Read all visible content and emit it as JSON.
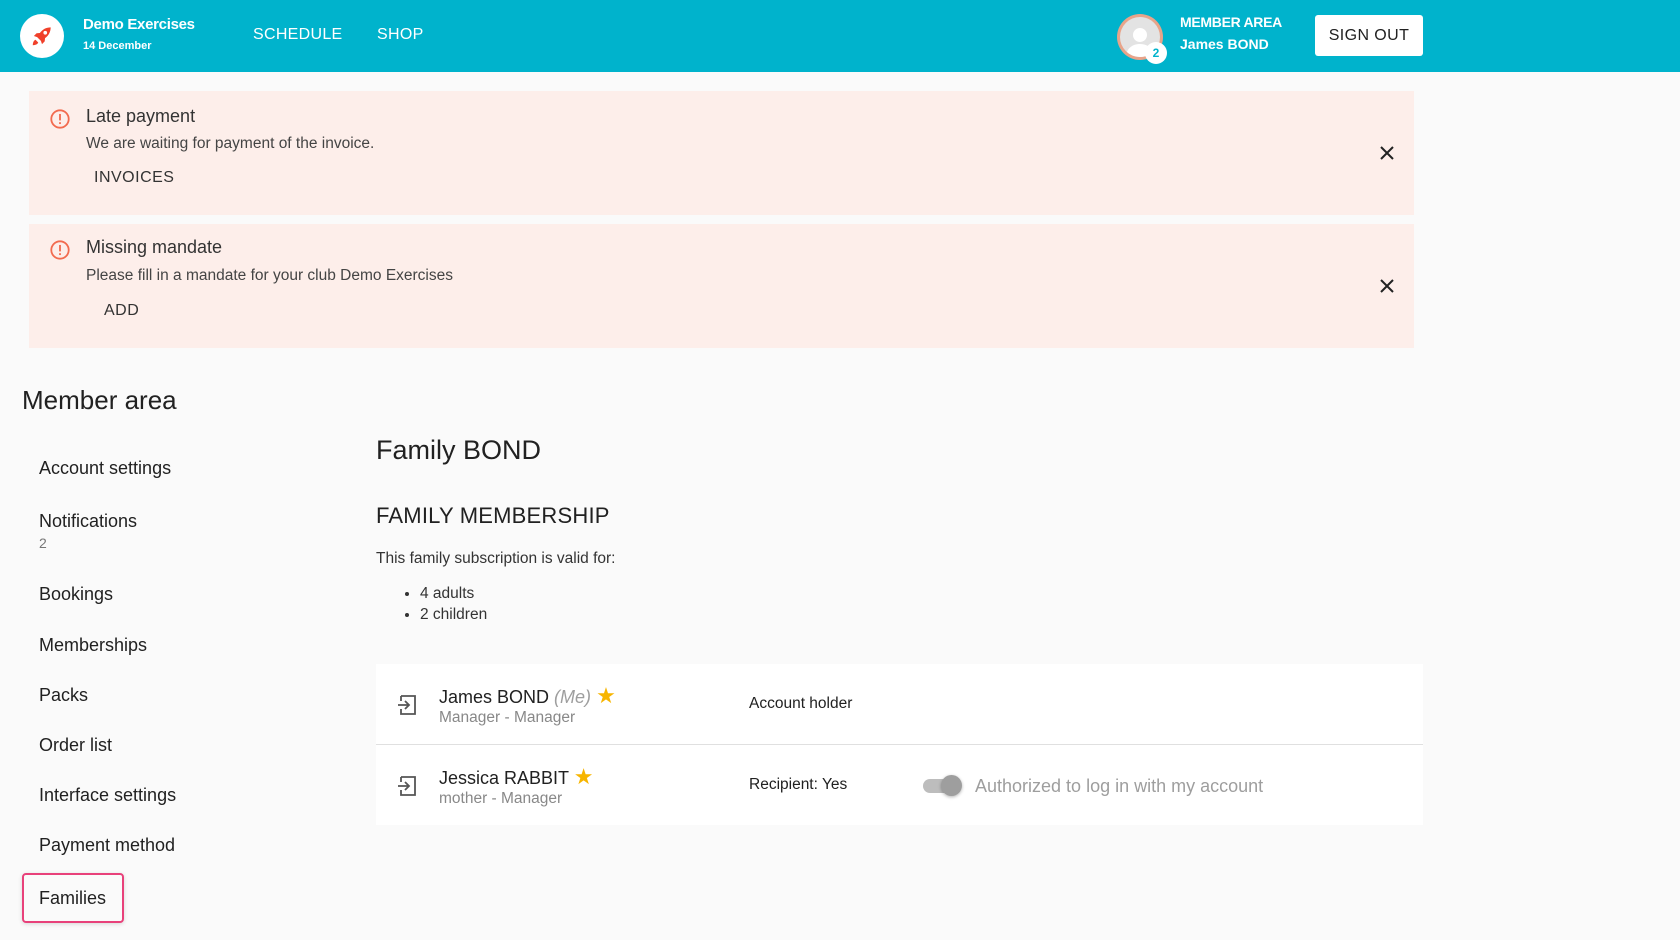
{
  "header": {
    "brand_name": "Demo Exercises",
    "brand_date": "14 December",
    "nav": [
      "SCHEDULE",
      "SHOP"
    ],
    "member_area_label": "MEMBER AREA",
    "member_name": "James BOND",
    "avatar_badge": "2",
    "sign_out_label": "SIGN OUT"
  },
  "alerts": [
    {
      "title": "Late payment",
      "text": "We are waiting for payment of the invoice.",
      "action": "INVOICES"
    },
    {
      "title": "Missing mandate",
      "text": "Please fill in a mandate for your club Demo Exercises",
      "action": "ADD"
    }
  ],
  "sidebar": {
    "title": "Member area",
    "items": [
      {
        "label": "Account settings"
      },
      {
        "label": "Notifications",
        "sub": "2"
      },
      {
        "label": "Bookings"
      },
      {
        "label": "Memberships"
      },
      {
        "label": "Packs"
      },
      {
        "label": "Order list"
      },
      {
        "label": "Interface settings"
      },
      {
        "label": "Payment method"
      },
      {
        "label": "Families"
      }
    ]
  },
  "main": {
    "family_title": "Family BOND",
    "membership_title": "FAMILY MEMBERSHIP",
    "valid_text": "This family subscription is valid for:",
    "valid_items": [
      "4 adults",
      "2 children"
    ],
    "members": [
      {
        "name": "James BOND",
        "me_tag": "(Me)",
        "star": "★",
        "role": "Manager - Manager",
        "status": "Account holder"
      },
      {
        "name": "Jessica RABBIT",
        "star": "★",
        "role": "mother - Manager",
        "status": "Recipient: Yes",
        "toggle_label": "Authorized to log in with my account",
        "toggle_on": true
      }
    ]
  },
  "colors": {
    "header_bg": "#00b3cc",
    "alert_bg": "#fdeeea",
    "alert_icon": "#f26b4f",
    "star": "#f7b500",
    "highlight": "#e8417a"
  }
}
